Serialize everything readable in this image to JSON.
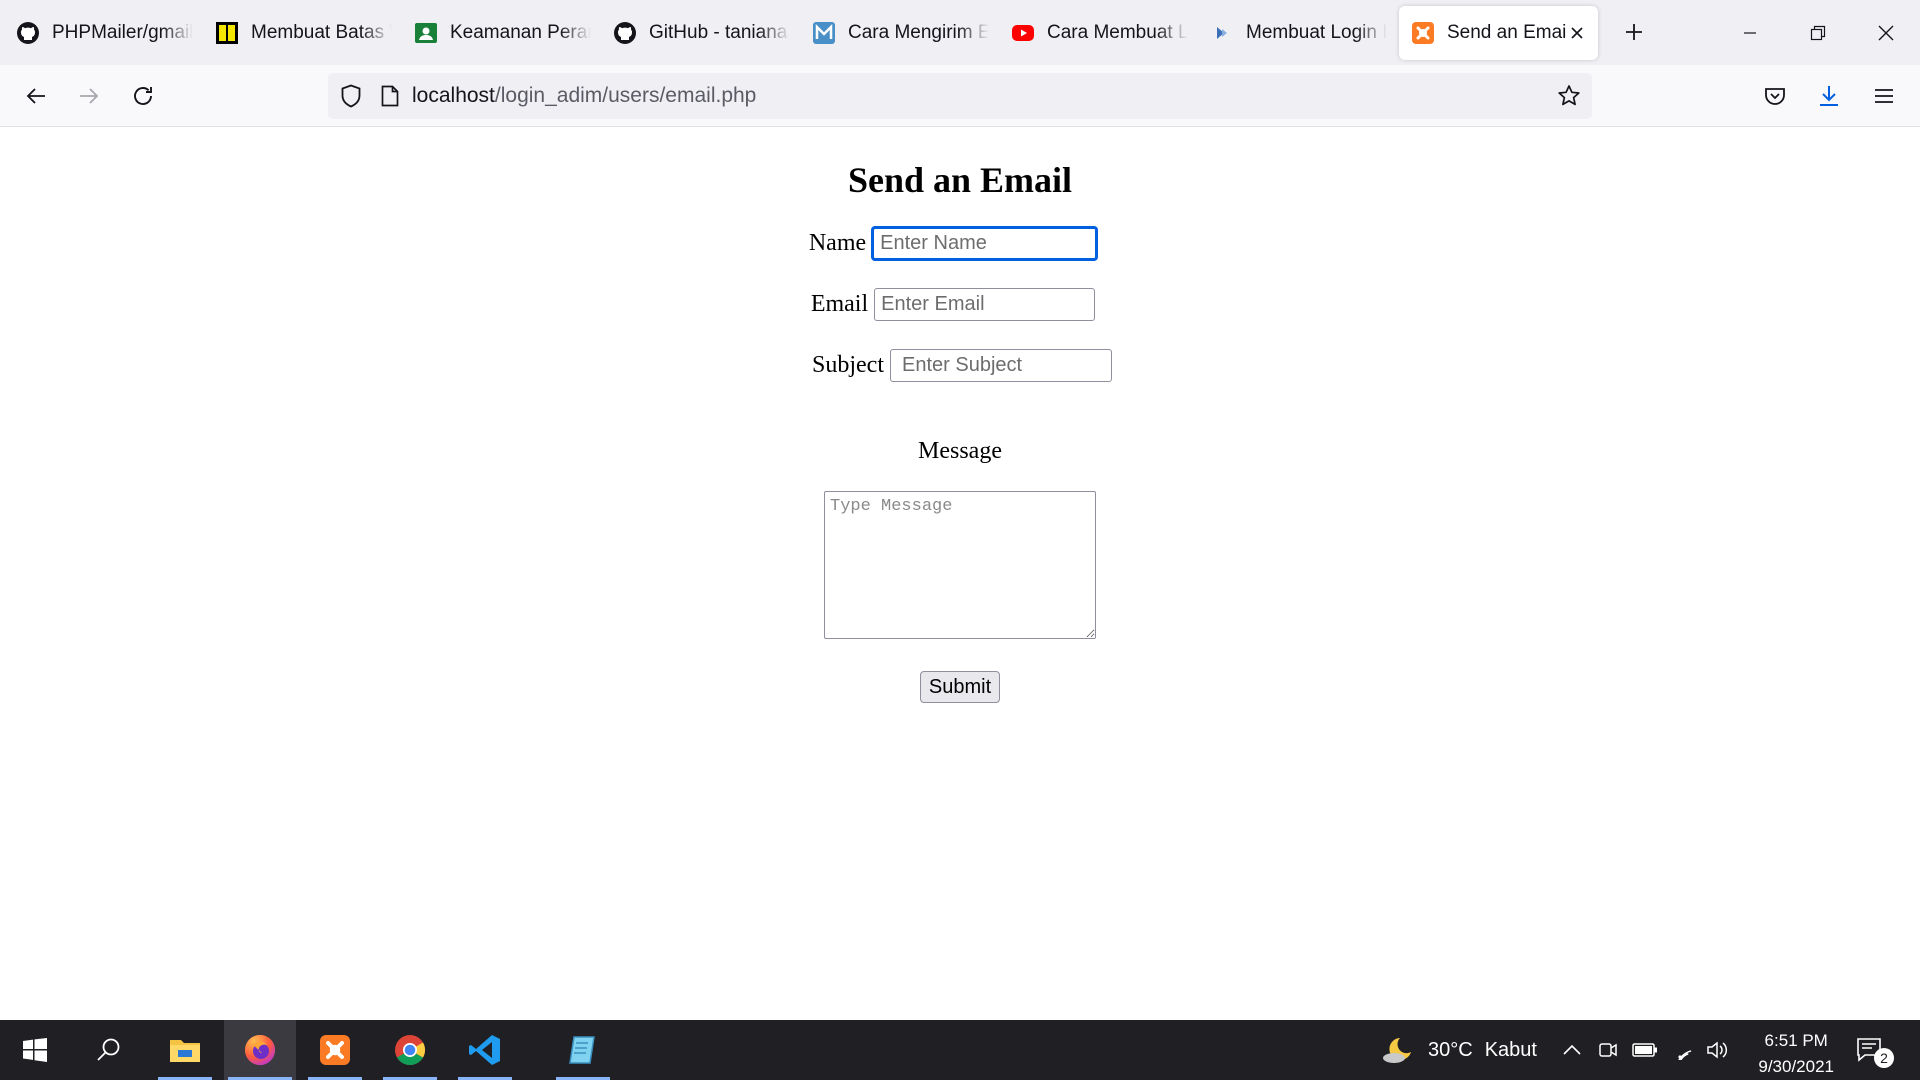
{
  "browser": {
    "tabs": [
      {
        "label": "PHPMailer/gmail",
        "icon": "github-icon",
        "active": false
      },
      {
        "label": "Membuat Batas W",
        "icon": "yellow-book-icon",
        "active": false
      },
      {
        "label": "Keamanan Peran",
        "icon": "green-person-icon",
        "active": false
      },
      {
        "label": "GitHub - taniana",
        "icon": "github-icon",
        "active": false
      },
      {
        "label": "Cara Mengirim E",
        "icon": "blue-m-icon",
        "active": false
      },
      {
        "label": "Cara Membuat L",
        "icon": "youtube-icon",
        "active": false
      },
      {
        "label": "Membuat Login I",
        "icon": "site-icon",
        "active": false
      },
      {
        "label": "Send an Email",
        "icon": "xampp-icon",
        "active": true
      }
    ],
    "url_host": "localhost",
    "url_path": "/login_adim/users/email.php"
  },
  "form": {
    "title": "Send an Email",
    "name_label": "Name",
    "name_placeholder": "Enter Name",
    "email_label": "Email",
    "email_placeholder": "Enter Email",
    "subject_label": "Subject",
    "subject_placeholder": "Enter Subject",
    "message_label": "Message",
    "message_placeholder": "Type Message",
    "submit_label": "Submit"
  },
  "taskbar": {
    "weather_temp": "30°C",
    "weather_text": "Kabut",
    "time": "6:51 PM",
    "date": "9/30/2021",
    "notification_count": "2"
  },
  "colors": {
    "accent": "#0060df",
    "taskbar_bg": "#1f1f24",
    "tabstrip_bg": "#f0f0f4"
  }
}
